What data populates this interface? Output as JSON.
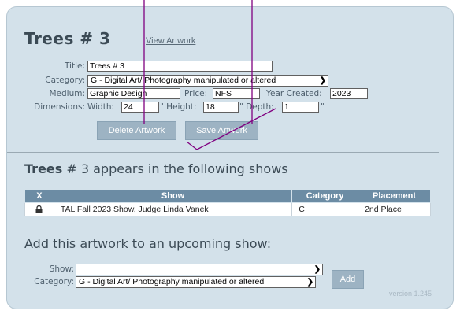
{
  "artwork": {
    "title_heading": "Trees # 3",
    "view_link": "View Artwork"
  },
  "form": {
    "title_label": "Title:",
    "title_value": "Trees # 3",
    "category_label": "Category:",
    "category_value": "G - Digital Art/ Photography manipulated or altered",
    "medium_label": "Medium:",
    "medium_value": "Graphic Design",
    "price_label": "Price:",
    "price_value": "NFS",
    "year_label": "Year Created:",
    "year_value": "2023",
    "dimensions_label": "Dimensions:",
    "width_label": "Width:",
    "width_value": "24",
    "width_unit": "\"",
    "height_label": "\" Height:",
    "height_value": "18",
    "depth_label": "\" Depth:",
    "depth_value": "1",
    "depth_unit": "\"",
    "delete_button": "Delete Artwork",
    "save_button": "Save Artwork"
  },
  "shows_section": {
    "heading_bold": "Trees",
    "heading_rest": " # 3 appears in the following shows",
    "columns": [
      "X",
      "Show",
      "Category",
      "Placement"
    ],
    "rows": [
      {
        "icon": "lock-icon",
        "show": "TAL Fall 2023 Show, Judge Linda Vanek",
        "category": "C",
        "placement": "2nd Place"
      }
    ]
  },
  "add_section": {
    "heading": "Add this artwork to an upcoming show:",
    "show_label": "Show:",
    "show_value": "",
    "category_label": "Category:",
    "category_value": "G - Digital Art/ Photography manipulated or altered",
    "add_button": "Add"
  },
  "version": "version 1.245",
  "colors": {
    "panel_bg": "#d3e1ea",
    "table_header": "#6c8ca4",
    "button_bg": "#9db3c3",
    "annotation_lines": "#800080"
  }
}
